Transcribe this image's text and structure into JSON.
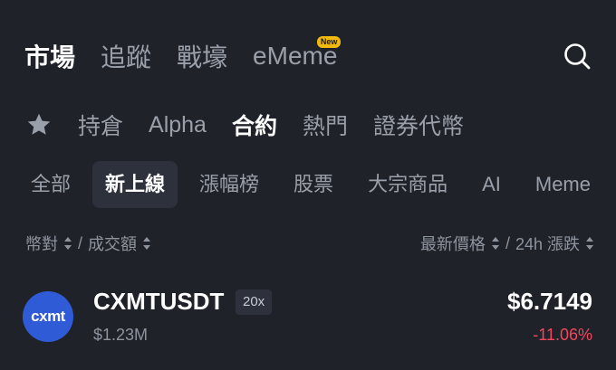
{
  "top_tabs": [
    {
      "label": "市場",
      "active": true
    },
    {
      "label": "追蹤",
      "active": false
    },
    {
      "label": "戰壕",
      "active": false
    },
    {
      "label": "eMeme",
      "active": false,
      "badge": "New"
    }
  ],
  "sub_tabs": {
    "favorites_icon": "star-icon",
    "items": [
      {
        "label": "持倉",
        "active": false
      },
      {
        "label": "Alpha",
        "active": false
      },
      {
        "label": "合約",
        "active": true
      },
      {
        "label": "熱門",
        "active": false
      },
      {
        "label": "證券代幣",
        "active": false
      }
    ]
  },
  "chips": [
    {
      "label": "全部",
      "active": false
    },
    {
      "label": "新上線",
      "active": true
    },
    {
      "label": "漲幅榜",
      "active": false
    },
    {
      "label": "股票",
      "active": false
    },
    {
      "label": "大宗商品",
      "active": false
    },
    {
      "label": "AI",
      "active": false
    },
    {
      "label": "Meme",
      "active": false
    }
  ],
  "columns": {
    "pair": "幣對",
    "separator_left": "/",
    "volume": "成交額",
    "price": "最新價格",
    "separator_right": "/",
    "change": "24h 漲跌"
  },
  "rows": [
    {
      "logo_text": "cxmt",
      "pair": "CXMTUSDT",
      "leverage": "20x",
      "volume": "$1.23M",
      "price": "$6.7149",
      "change": "-11.06%"
    }
  ],
  "colors": {
    "background": "#1f2229",
    "chip_active_bg": "#2c313b",
    "badge": "#f0b90b",
    "negative": "#f6465d",
    "logo_bg": "#2f5bd6"
  }
}
